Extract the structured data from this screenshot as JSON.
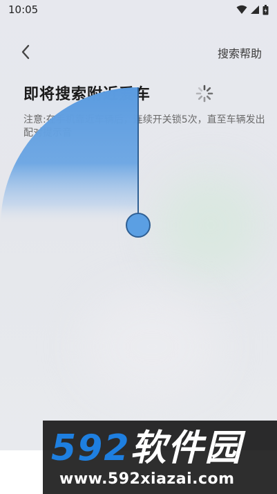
{
  "status_bar": {
    "time": "10:05",
    "icons": [
      "wifi-icon",
      "signal-icon",
      "battery-icon"
    ]
  },
  "header": {
    "back_icon": "chevron-left-icon",
    "help_label": "搜索帮助"
  },
  "main": {
    "title": "即将搜索附近爱车",
    "hint": "注意:在手机靠近车辆后，连续开关锁5次，直至车辆发出配对提示音",
    "radar_color": "#5a9be0"
  },
  "watermark": {
    "logo_number": "592",
    "logo_text": "软件园",
    "url": "www.592xiazai.com",
    "number_color": "#1e7fe0"
  }
}
